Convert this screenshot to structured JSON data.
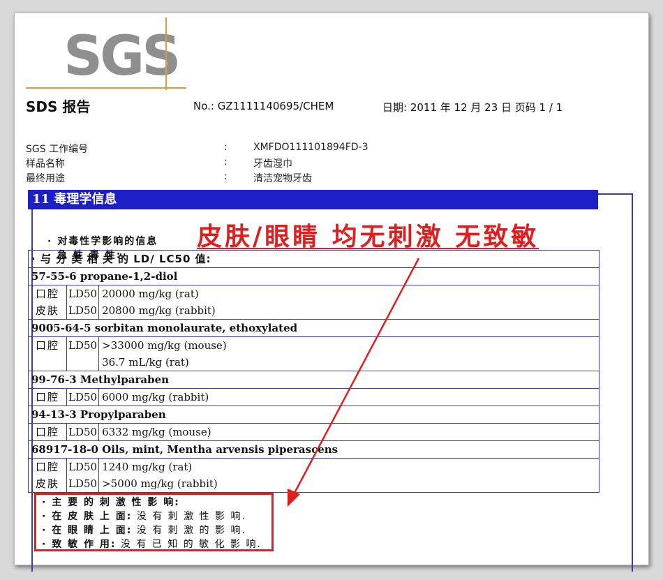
{
  "logo": {
    "text": "SGS"
  },
  "header": {
    "title": "SDS 报告",
    "report_no": "No.: GZ1111140695/CHEM",
    "date_page": "日期: 2011 年 12 月 23 日  页码 1 / 1"
  },
  "info": [
    {
      "key": "SGS 工作编号",
      "colon": ":",
      "value": "XMFDO111101894FD-3"
    },
    {
      "key": "样品名称",
      "colon": ":",
      "value": "牙齿湿巾"
    },
    {
      "key": "最终用途",
      "colon": ":",
      "value": "清洁宠物牙齿"
    }
  ],
  "section": {
    "header": "11 毒理学信息",
    "line1": "· 对毒性学影响的信息",
    "line2": "· 急 性 毒 性:",
    "ld_header": "· 与 分 类 相 关 的 LD/ LC50 值:"
  },
  "annotation": "皮肤/眼睛 均无刺激 无致敏",
  "substances": [
    {
      "name": "57-55-6 propane-1,2-diol",
      "rows": [
        {
          "route": "口腔",
          "type": "LD50",
          "values": [
            "20000 mg/kg (rat)"
          ]
        },
        {
          "route": "皮肤",
          "type": "LD50",
          "values": [
            "20800 mg/kg (rabbit)"
          ]
        }
      ]
    },
    {
      "name": "9005-64-5 sorbitan monolaurate, ethoxylated",
      "rows": [
        {
          "route": "口腔",
          "type": "LD50",
          "values": [
            ">33000 mg/kg (mouse)",
            "36.7 mL/kg (rat)"
          ]
        }
      ]
    },
    {
      "name": "99-76-3 Methylparaben",
      "rows": [
        {
          "route": "口腔",
          "type": "LD50",
          "values": [
            "6000 mg/kg (rabbit)"
          ]
        }
      ]
    },
    {
      "name": "94-13-3 Propylparaben",
      "rows": [
        {
          "route": "口腔",
          "type": "LD50",
          "values": [
            "6332 mg/kg (mouse)"
          ]
        }
      ]
    },
    {
      "name": "68917-18-0 Oils, mint, Mentha arvensis piperascens",
      "rows": [
        {
          "route": "口腔",
          "type": "LD50",
          "values": [
            "1240 mg/kg (rat)"
          ]
        },
        {
          "route": "皮肤",
          "type": "LD50",
          "values": [
            ">5000 mg/kg (rabbit)"
          ]
        }
      ]
    }
  ],
  "irritation": {
    "title": "· 主 要 的 刺 激 性 影 响:",
    "skin_label": "· 在 皮 肤 上 面:",
    "skin_value": "没 有 刺 激 性 影 响.",
    "eye_label": "· 在 眼 睛 上 面:",
    "eye_value": "没 有 刺 激 的 影 响.",
    "sens_label": "· 致 敏 作 用:",
    "sens_value": "没 有 已 知 的 敏 化 影 响."
  },
  "colors": {
    "section_header": "#1c1fc6",
    "annotation": "#e01e1e",
    "logo_gray": "#8f8f8f",
    "logo_line": "#e39a3c"
  }
}
